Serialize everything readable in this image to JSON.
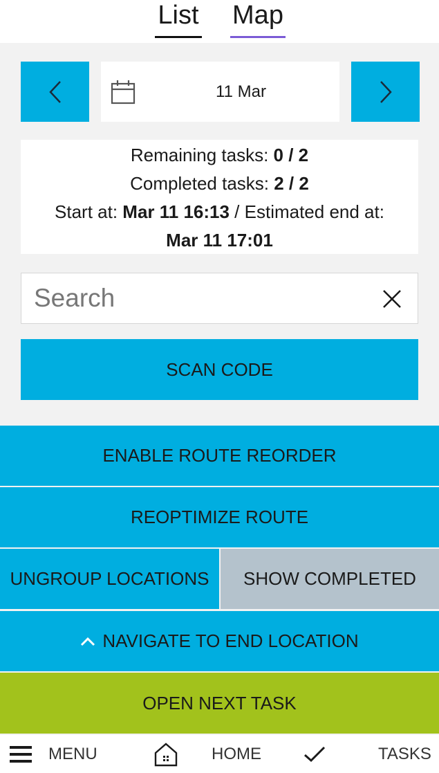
{
  "tabs": {
    "list_label": "List",
    "map_label": "Map"
  },
  "date_nav": {
    "date": "11 Mar",
    "prev_icon": "chevron-left-icon",
    "next_icon": "chevron-right-icon",
    "calendar_icon": "calendar-icon"
  },
  "summary": {
    "remaining_label": "Remaining tasks: ",
    "remaining_value": "0 / 2",
    "completed_label": "Completed tasks: ",
    "completed_value": "2 / 2",
    "start_label": "Start at: ",
    "start_value": "Mar 11 16:13",
    "end_label": " / Estimated end at:",
    "end_value": "Mar 11 17:01"
  },
  "search": {
    "placeholder": "Search",
    "value": "",
    "clear_icon": "close-icon"
  },
  "actions": {
    "scan_code": "SCAN CODE",
    "enable_route_reorder": "ENABLE ROUTE REORDER",
    "reoptimize_route": "REOPTIMIZE ROUTE",
    "ungroup_locations": "UNGROUP LOCATIONS",
    "show_completed": "SHOW COMPLETED",
    "navigate_to_end": "NAVIGATE TO END LOCATION",
    "open_next_task": "OPEN NEXT TASK"
  },
  "bottom_nav": {
    "menu_label": "MENU",
    "home_label": "HOME",
    "tasks_label": "TASKS"
  },
  "colors": {
    "accent": "#00aee0",
    "show_completed_bg": "#b4c2cc",
    "open_next_task_bg": "#a2c21c",
    "map_tab_underline": "#7b5bd6"
  }
}
